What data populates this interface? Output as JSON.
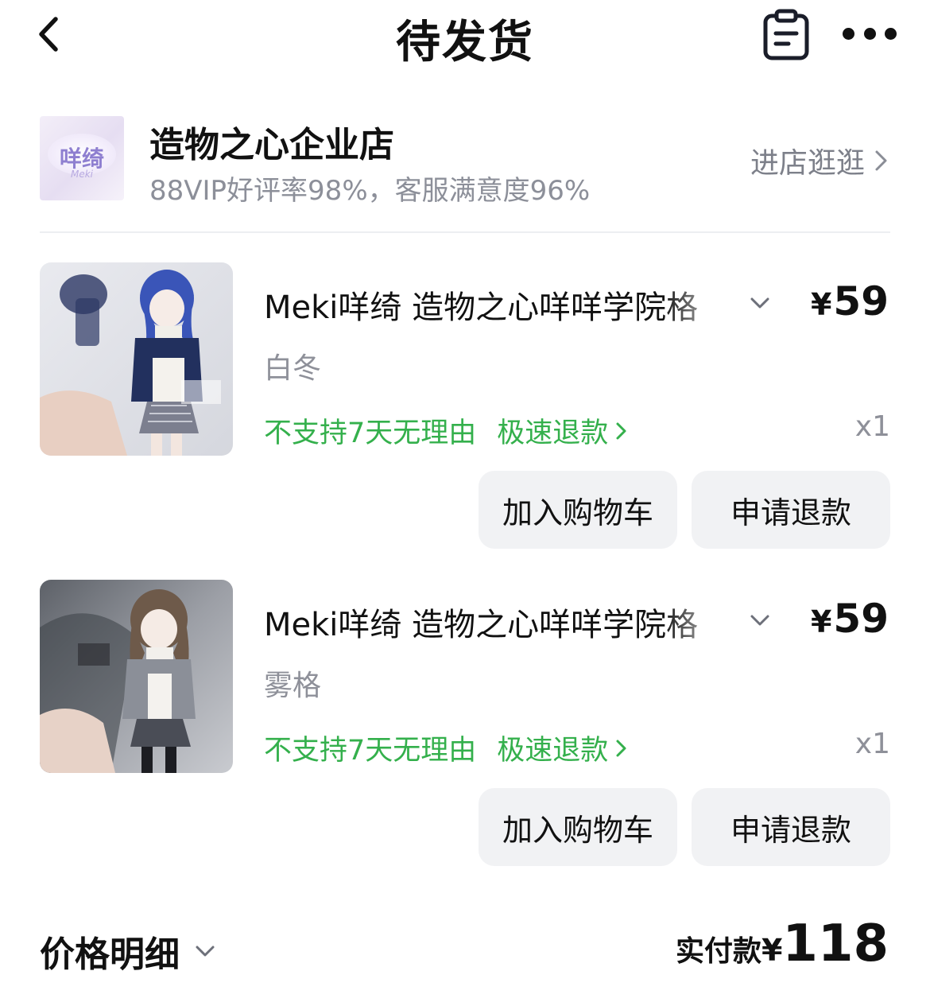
{
  "header": {
    "title": "待发货",
    "back_icon": "chevron-left-icon",
    "orders_icon": "clipboard-icon",
    "more_icon": "more-horizontal-icon"
  },
  "shop": {
    "logo_text": "咩绮",
    "logo_sub": "Meki",
    "name": "造物之心企业店",
    "stats": "88VIP好评率98%，客服满意度96%",
    "enter_label": "进店逛逛"
  },
  "items": [
    {
      "title": "Meki咩绮 造物之心咩咩学院格",
      "price_symbol": "¥",
      "price": "59",
      "variant": "白冬",
      "service_no_return": "不支持7天无理由",
      "service_refund": "极速退款",
      "qty": "x1",
      "btn_cart": "加入购物车",
      "btn_refund": "申请退款"
    },
    {
      "title": "Meki咩绮 造物之心咩咩学院格",
      "price_symbol": "¥",
      "price": "59",
      "variant": "雾格",
      "service_no_return": "不支持7天无理由",
      "service_refund": "极速退款",
      "qty": "x1",
      "btn_cart": "加入购物车",
      "btn_refund": "申请退款"
    }
  ],
  "footer": {
    "price_detail_label": "价格明细",
    "total_label": "实付款",
    "total_symbol": "¥",
    "total_amount": "118"
  },
  "colors": {
    "green": "#34b04c",
    "gray_text": "#8e9099",
    "button_bg": "#f1f2f4"
  }
}
